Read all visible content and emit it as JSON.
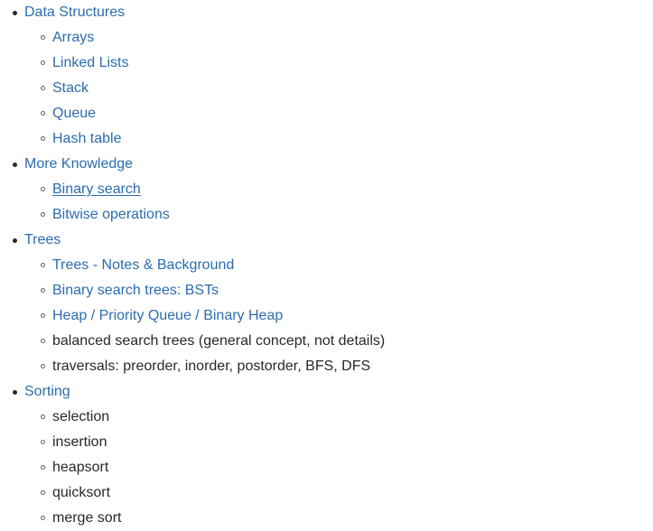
{
  "page": {
    "background": "#ffffff",
    "link_color": "#2b6cb0",
    "text_color": "#24292e",
    "marker_color": "#57606a"
  },
  "outline": [
    {
      "label": "Data Structures",
      "type": "link",
      "children": [
        {
          "label": "Arrays",
          "type": "link"
        },
        {
          "label": "Linked Lists",
          "type": "link"
        },
        {
          "label": "Stack",
          "type": "link"
        },
        {
          "label": "Queue",
          "type": "link"
        },
        {
          "label": "Hash table",
          "type": "link"
        }
      ]
    },
    {
      "label": "More Knowledge",
      "type": "link",
      "children": [
        {
          "label": "Binary search",
          "type": "link",
          "underlined": true
        },
        {
          "label": "Bitwise operations",
          "type": "link"
        }
      ]
    },
    {
      "label": "Trees",
      "type": "link",
      "children": [
        {
          "label": "Trees - Notes & Background",
          "type": "link"
        },
        {
          "label": "Binary search trees: BSTs",
          "type": "link"
        },
        {
          "label": "Heap / Priority Queue / Binary Heap",
          "type": "link"
        },
        {
          "label": "balanced search trees (general concept, not details)",
          "type": "text"
        },
        {
          "label": "traversals: preorder, inorder, postorder, BFS, DFS",
          "type": "text"
        }
      ]
    },
    {
      "label": "Sorting",
      "type": "link",
      "children": [
        {
          "label": "selection",
          "type": "text"
        },
        {
          "label": "insertion",
          "type": "text"
        },
        {
          "label": "heapsort",
          "type": "text"
        },
        {
          "label": "quicksort",
          "type": "text"
        },
        {
          "label": "merge sort",
          "type": "text"
        }
      ]
    }
  ]
}
